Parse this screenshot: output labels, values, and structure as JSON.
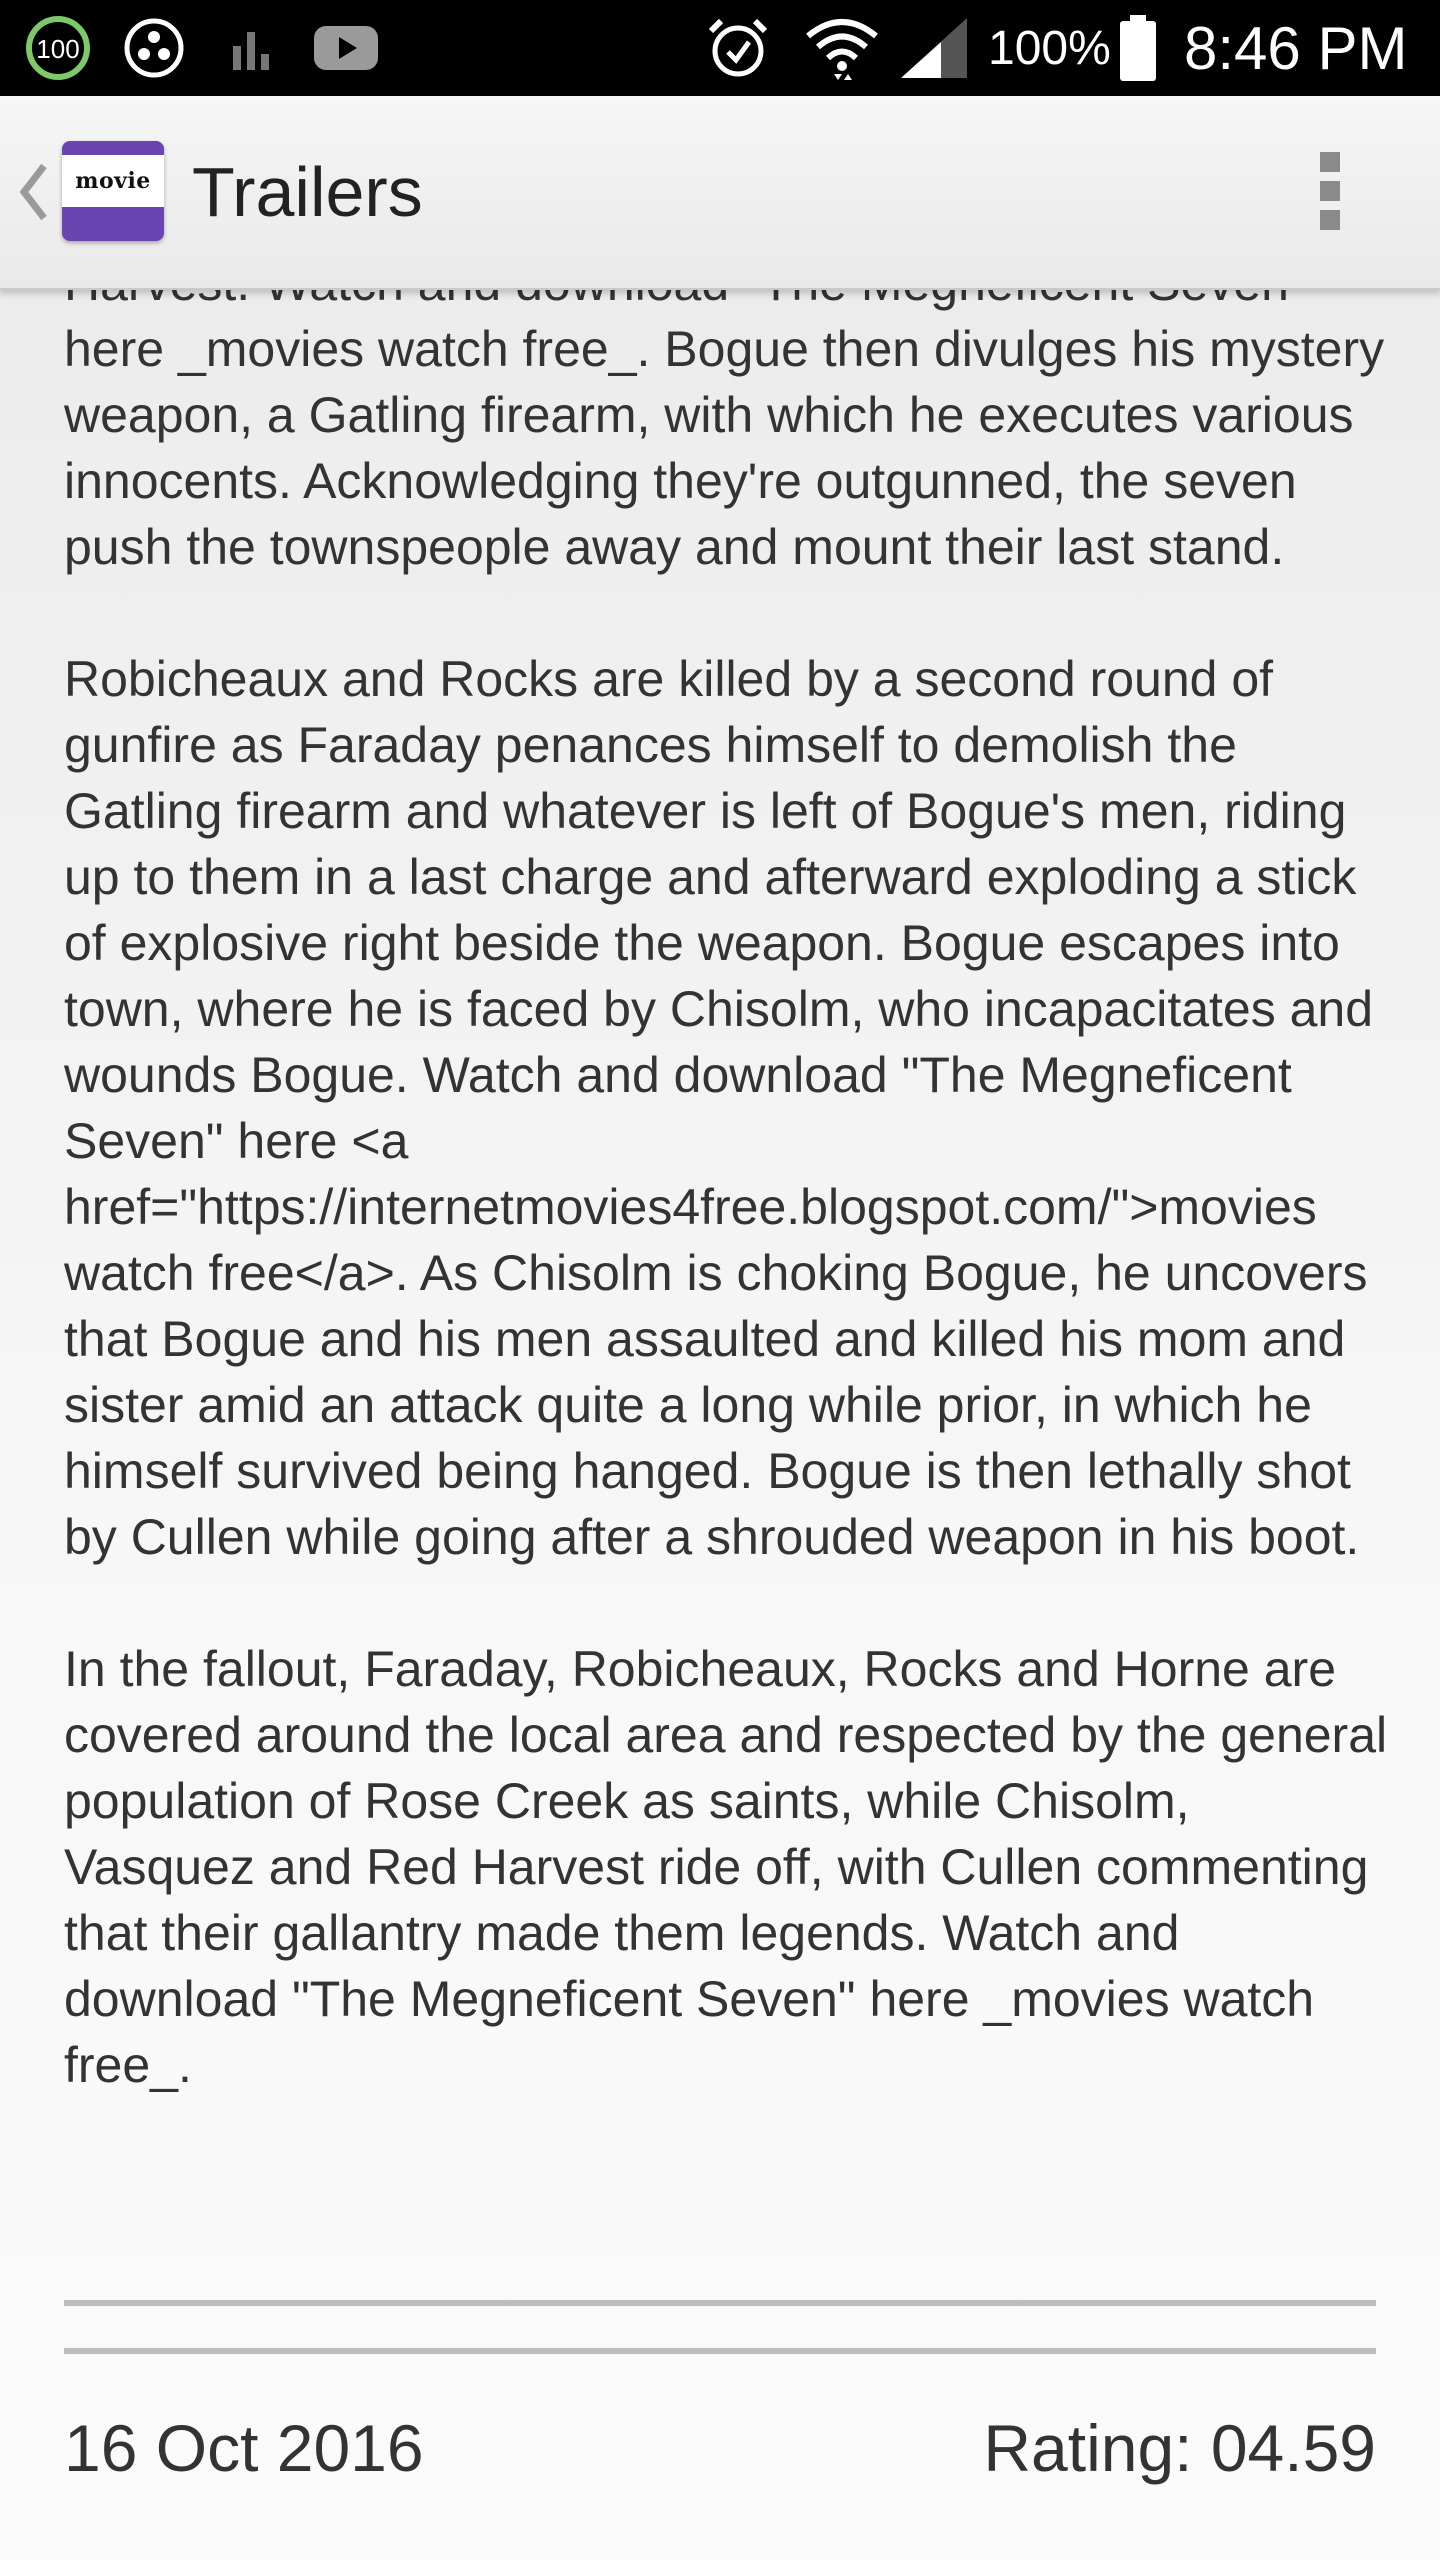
{
  "status_bar": {
    "notification_badge": "100",
    "battery_percent": "100%",
    "time": "8:46 PM",
    "icons": [
      "badge-100-icon",
      "circle-dots-icon",
      "bar-chart-icon",
      "youtube-icon",
      "alarm-icon",
      "wifi-icon",
      "signal-icon",
      "battery-icon"
    ]
  },
  "action_bar": {
    "title": "Trailers",
    "logo_text": "movie",
    "colors": {
      "logo_purple": "#6a44b0"
    }
  },
  "article": {
    "lead_fragment": "Harvest. Watch and download \"The Megneficent Seven\" here _movies watch free_. Bogue then divulges his mystery weapon, a Gatling firearm, with which he executes various innocents. Acknowledging they're outgunned, the seven push the townspeople away and mount their last stand.",
    "paragraph_2": "Robicheaux and Rocks are killed by a second round of gunfire as Faraday penances himself to demolish the Gatling firearm and whatever is left of Bogue's men, riding up to them in a last charge and afterward exploding a stick of explosive right beside the weapon. Bogue escapes into town, where he is faced by Chisolm, who incapacitates and wounds Bogue. Watch and download \"The Megneficent Seven\" here <a href=\"https://internetmovies4free.blogspot.com/\">movies watch free</a>. As Chisolm is choking Bogue, he uncovers that Bogue and his men assaulted and killed his mom and sister amid an attack quite a long while prior, in which he himself survived being hanged. Bogue is then lethally shot by Cullen while going after a shrouded weapon in his boot.",
    "paragraph_3": "In the fallout, Faraday, Robicheaux, Rocks and Horne are covered around the local area and respected by the general population of Rose Creek as saints, while Chisolm, Vasquez and Red Harvest ride off, with Cullen commenting that their gallantry made them legends. Watch and download \"The Megneficent Seven\" here _movies watch free_."
  },
  "footer": {
    "date": "16 Oct 2016",
    "rating": "Rating: 04.59"
  }
}
